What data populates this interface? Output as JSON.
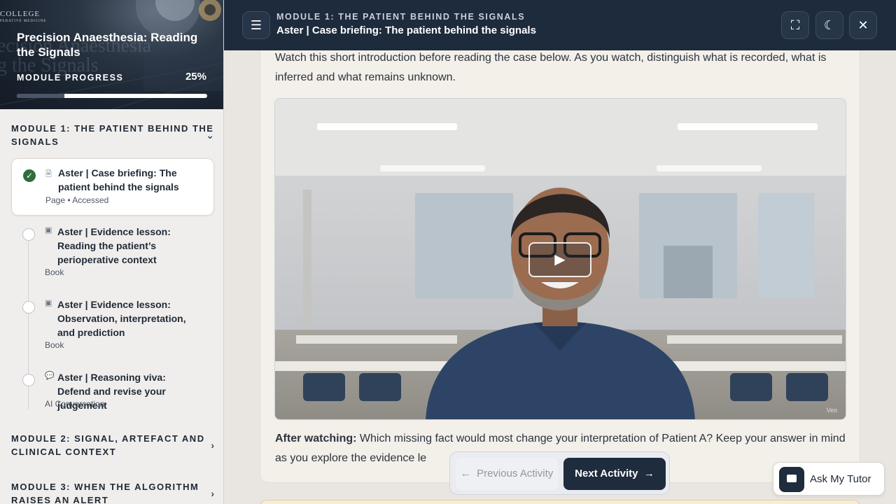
{
  "course": {
    "college": "COLLEGE",
    "college_sub": "PERATIVE MEDICINE",
    "ghost_text": "ecision Anaesthesia",
    "ghost_text_2": "g the Signals",
    "title": "Precision Anaesthesia: Reading the Signals",
    "progress_label": "MODULE PROGRESS",
    "progress_value": "25%",
    "progress_fraction": 0.25
  },
  "modules": [
    {
      "title": "MODULE 1: THE PATIENT BEHIND THE SIGNALS",
      "expanded": true,
      "icon": "chevron-down-icon"
    },
    {
      "title": "MODULE 2: SIGNAL, ARTEFACT AND CLINICAL CONTEXT",
      "expanded": false,
      "icon": "chevron-right-icon"
    },
    {
      "title": "MODULE 3: WHEN THE ALGORITHM RAISES AN ALERT",
      "expanded": false,
      "icon": "chevron-right-icon"
    }
  ],
  "activities": [
    {
      "title": "Aster | Case briefing: The patient behind the signals",
      "meta": "Page • Accessed",
      "status": "completed",
      "type_icon": "page-icon"
    },
    {
      "title": "Aster | Evidence lesson: Reading the patient’s perioperative context",
      "meta": "Book",
      "status": "not-started",
      "type_icon": "book-icon"
    },
    {
      "title": "Aster | Evidence lesson: Observation, interpretation, and prediction",
      "meta": "Book",
      "status": "not-started",
      "type_icon": "book-icon"
    },
    {
      "title": "Aster | Reasoning viva: Defend and revise your judgement",
      "meta": "AI Conversation",
      "status": "not-started",
      "type_icon": "chat-icon"
    }
  ],
  "topbar": {
    "kicker": "MODULE 1: THE PATIENT BEHIND THE SIGNALS",
    "title": "Aster | Case briefing: The patient behind the signals",
    "menu_icon": "hamburger-icon",
    "fullscreen_icon": "fullscreen-icon",
    "theme_icon": "moon-icon",
    "close_icon": "close-icon"
  },
  "content": {
    "intro": "Watch this short introduction before reading the case below. As you watch, distinguish what is recorded, what is inferred and what remains unknown.",
    "video_watermark": "Veo",
    "after_label": "After watching:",
    "after_text": " Which missing fact would most change your interpretation of Patient A? Keep your answer in mind as you explore the evidence le"
  },
  "nav": {
    "prev_label": "Previous Activity",
    "next_label": "Next Activity"
  },
  "tutor": {
    "label": "Ask My Tutor"
  },
  "colors": {
    "navy": "#1d2b3c",
    "success": "#2e6e3c",
    "card_bg": "#f3efe9"
  }
}
